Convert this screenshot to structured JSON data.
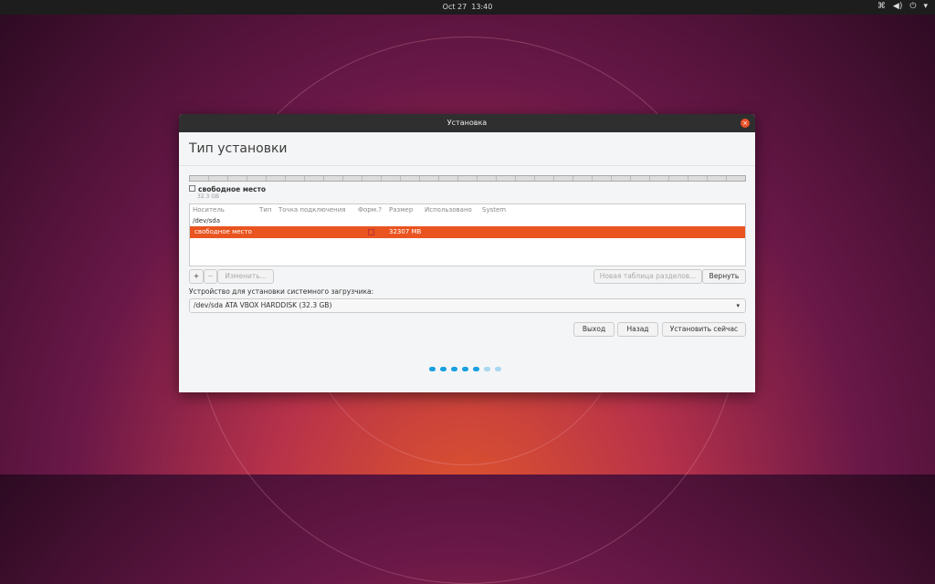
{
  "topbar": {
    "date": "Oct 27",
    "time": "13:40",
    "icons": [
      "network-icon",
      "volume-icon",
      "power-icon",
      "menu-arrow-icon"
    ]
  },
  "window": {
    "title": "Установка",
    "heading": "Тип установки",
    "legend": {
      "label": "свободное место",
      "size": "32.3 GB"
    },
    "table": {
      "columns": [
        "Носитель",
        "Тип",
        "Точка подключения",
        "Форм.?",
        "Размер",
        "Использовано",
        "System"
      ],
      "device": "/dev/sda",
      "rows": [
        {
          "device": "свободное место",
          "type": "",
          "mount": "",
          "format": false,
          "size": "32307 MB",
          "used": "",
          "system": ""
        }
      ]
    },
    "buttons": {
      "add": "+",
      "remove": "−",
      "change": "Изменить...",
      "new_table": "Новая таблица разделов...",
      "revert": "Вернуть",
      "quit": "Выход",
      "back": "Назад",
      "install": "Установить сейчас"
    },
    "bootloader_label": "Устройство для установки системного загрузчика:",
    "bootloader_value": "/dev/sda ATA VBOX HARDDISK (32.3 GB)",
    "progress": {
      "total": 7,
      "completed": 5
    }
  }
}
